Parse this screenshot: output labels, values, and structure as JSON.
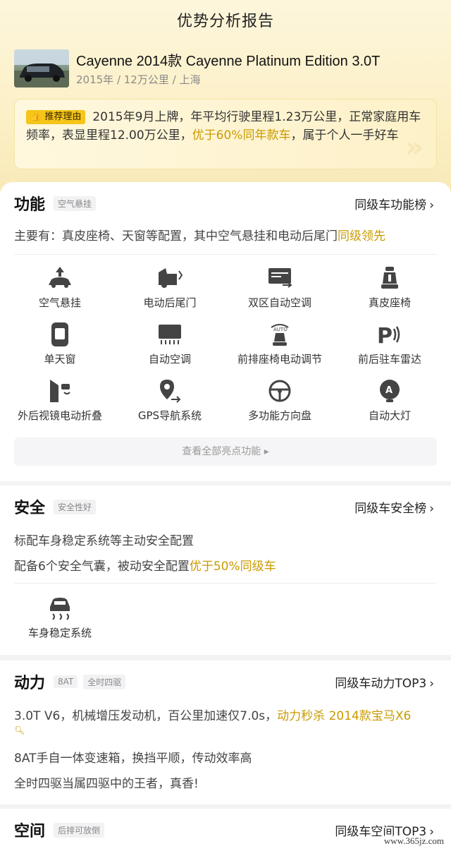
{
  "page": {
    "title": "优势分析报告"
  },
  "car": {
    "name": "Cayenne 2014款 Cayenne Platinum Edition 3.0T",
    "meta": "2015年 / 12万公里 / 上海"
  },
  "reason": {
    "tag": "推荐理由",
    "text_before": "2015年9月上牌，年平均行驶里程1.23万公里，正常家庭用车频率，表显里程12.00万公里，",
    "highlight": "优于60%同年款车",
    "text_after": "，属于个人一手好车"
  },
  "features_section": {
    "title": "功能",
    "tag": "空气悬挂",
    "link": "同级车功能榜",
    "desc_before": "主要有：真皮座椅、天窗等配置，其中空气悬挂和电动后尾门",
    "desc_highlight": "同级领先",
    "items": [
      {
        "label": "空气悬挂",
        "icon": "air-suspension-icon"
      },
      {
        "label": "电动后尾门",
        "icon": "power-tailgate-icon"
      },
      {
        "label": "双区自动空调",
        "icon": "dual-zone-ac-icon"
      },
      {
        "label": "真皮座椅",
        "icon": "leather-seat-icon"
      },
      {
        "label": "单天窗",
        "icon": "sunroof-icon"
      },
      {
        "label": "自动空调",
        "icon": "auto-ac-icon"
      },
      {
        "label": "前排座椅电动调节",
        "icon": "power-seat-icon"
      },
      {
        "label": "前后驻车雷达",
        "icon": "parking-radar-icon"
      },
      {
        "label": "外后视镜电动折叠",
        "icon": "mirror-fold-icon"
      },
      {
        "label": "GPS导航系统",
        "icon": "gps-icon"
      },
      {
        "label": "多功能方向盘",
        "icon": "steering-wheel-icon"
      },
      {
        "label": "自动大灯",
        "icon": "auto-headlight-icon"
      }
    ],
    "more": "查看全部亮点功能 ▸"
  },
  "safety_section": {
    "title": "安全",
    "tag": "安全性好",
    "link": "同级车安全榜",
    "line1": "标配车身稳定系统等主动安全配置",
    "line2_before": "配备6个安全气囊，被动安全配置",
    "line2_highlight": "优于50%同级车",
    "items": [
      {
        "label": "车身稳定系统",
        "icon": "stability-control-icon"
      }
    ]
  },
  "power_section": {
    "title": "动力",
    "tags": [
      "8AT",
      "全时四驱"
    ],
    "link": "同级车动力TOP3",
    "line1_before": "3.0T V6，机械增压发动机，百公里加速仅7.0s，",
    "line1_highlight": "动力秒杀 2014款宝马X6",
    "line2": "8AT手自一体变速箱，换挡平顺，传动效率高",
    "line3": "全时四驱当属四驱中的王者，真香!"
  },
  "space_section": {
    "title": "空间",
    "tag": "后排可放倒",
    "link": "同级车空间TOP3"
  },
  "watermark": "www.365jz.com",
  "colors": {
    "accent": "#c99a00",
    "tag_yellow": "#f5c518",
    "top_bg": "#fbefc4"
  }
}
